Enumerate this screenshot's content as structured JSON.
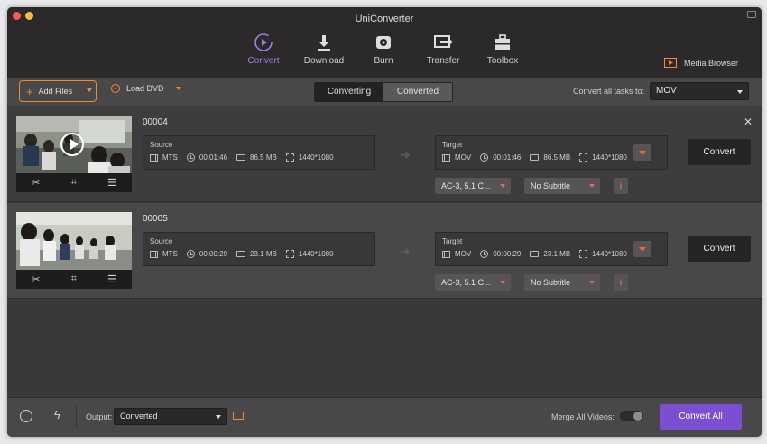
{
  "app": {
    "title": "UniConverter"
  },
  "nav": {
    "tabs": [
      {
        "label": "Convert",
        "icon": "convert-play-icon",
        "active": true
      },
      {
        "label": "Download",
        "icon": "download-icon",
        "active": false
      },
      {
        "label": "Burn",
        "icon": "burn-disc-icon",
        "active": false
      },
      {
        "label": "Transfer",
        "icon": "transfer-icon",
        "active": false
      },
      {
        "label": "Toolbox",
        "icon": "toolbox-icon",
        "active": false
      }
    ],
    "media_browser": "Media Browser"
  },
  "toolbar": {
    "add_files": "Add Files",
    "load_dvd": "Load DVD",
    "tab_converting": "Converting",
    "tab_converted": "Converted",
    "convert_all_tasks_label": "Convert all tasks to:",
    "convert_all_tasks_value": "MOV"
  },
  "files": [
    {
      "name": "00004",
      "source": {
        "label": "Source",
        "format": "MTS",
        "duration": "00:01:46",
        "size": "86.5 MB",
        "resolution": "1440*1080"
      },
      "target": {
        "label": "Target",
        "format": "MOV",
        "duration": "00:01:46",
        "size": "86.5 MB",
        "resolution": "1440*1080"
      },
      "audio": "AC-3, 5.1 C...",
      "subtitle": "No Subtitle",
      "info": "i",
      "convert": "Convert"
    },
    {
      "name": "00005",
      "source": {
        "label": "Source",
        "format": "MTS",
        "duration": "00:00:29",
        "size": "23.1 MB",
        "resolution": "1440*1080"
      },
      "target": {
        "label": "Target",
        "format": "MOV",
        "duration": "00:00:29",
        "size": "23.1 MB",
        "resolution": "1440*1080"
      },
      "audio": "AC-3, 5.1 C...",
      "subtitle": "No Subtitle",
      "info": "i",
      "convert": "Convert"
    }
  ],
  "bottom": {
    "output_label": "Output:",
    "output_value": "Converted",
    "merge_label": "Merge All Videos:",
    "merge_on": false,
    "convert_all": "Convert All"
  },
  "colors": {
    "accent": "#7b4fd1",
    "orange": "#f08a3c",
    "active_tab": "#a37ae8"
  }
}
